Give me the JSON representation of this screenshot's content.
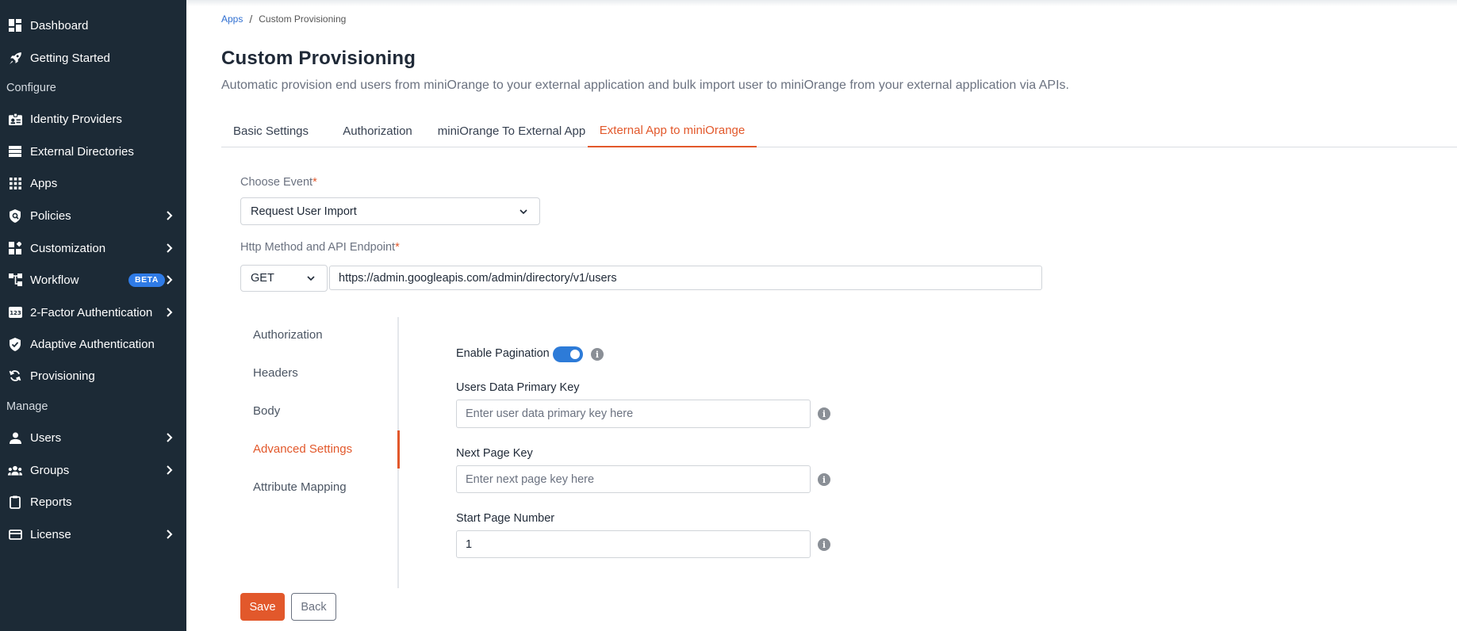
{
  "sidebar": {
    "items": [
      {
        "label": "Dashboard",
        "icon": "dashboard-icon"
      },
      {
        "label": "Getting Started",
        "icon": "rocket-icon"
      },
      {
        "label": "Identity Providers",
        "icon": "id-badge-icon"
      },
      {
        "label": "External Directories",
        "icon": "directory-icon"
      },
      {
        "label": "Apps",
        "icon": "apps-grid-icon"
      },
      {
        "label": "Policies",
        "icon": "shield-icon"
      },
      {
        "label": "Customization",
        "icon": "widgets-icon"
      },
      {
        "label": "Workflow",
        "icon": "workflow-icon",
        "badge": "BETA"
      },
      {
        "label": "2-Factor Authentication",
        "icon": "two-factor-icon"
      },
      {
        "label": "Adaptive Authentication",
        "icon": "verified-shield-icon"
      },
      {
        "label": "Provisioning",
        "icon": "sync-icon"
      },
      {
        "label": "Users",
        "icon": "user-icon"
      },
      {
        "label": "Groups",
        "icon": "groups-icon"
      },
      {
        "label": "Reports",
        "icon": "clipboard-icon"
      },
      {
        "label": "License",
        "icon": "card-icon"
      }
    ],
    "sections": {
      "configure": "Configure",
      "manage": "Manage"
    }
  },
  "breadcrumb": {
    "parent": "Apps",
    "separator": "/",
    "current": "Custom Provisioning"
  },
  "page": {
    "title": "Custom Provisioning",
    "description": "Automatic provision end users from miniOrange to your external application and bulk import user to miniOrange from your external application via APIs."
  },
  "tabs": [
    {
      "label": "Basic Settings"
    },
    {
      "label": "Authorization"
    },
    {
      "label": "miniOrange To External App"
    },
    {
      "label": "External App to miniOrange",
      "active": true
    }
  ],
  "form": {
    "choose_event_label": "Choose Event",
    "choose_event_value": "Request User Import",
    "http_label": "Http Method and API Endpoint",
    "method_value": "GET",
    "endpoint_value": "https://admin.googleapis.com/admin/directory/v1/users",
    "required_mark": "*"
  },
  "subnav": [
    {
      "label": "Authorization"
    },
    {
      "label": "Headers"
    },
    {
      "label": "Body"
    },
    {
      "label": "Advanced Settings",
      "active": true
    },
    {
      "label": "Attribute Mapping"
    }
  ],
  "advanced": {
    "enable_pagination_label": "Enable Pagination",
    "enable_pagination_on": true,
    "primary_key_label": "Users Data Primary Key",
    "primary_key_placeholder": "Enter user data primary key here",
    "next_page_label": "Next Page Key",
    "next_page_placeholder": "Enter next page key here",
    "start_page_label": "Start Page Number",
    "start_page_value": "1",
    "info_glyph": "i"
  },
  "buttons": {
    "save": "Save",
    "back": "Back"
  },
  "colors": {
    "sidebar_bg": "#1c2a36",
    "accent": "#e2582b",
    "toggle_on": "#2d7bd8",
    "beta_badge": "#2f7be6",
    "link": "#2f6fd1"
  }
}
